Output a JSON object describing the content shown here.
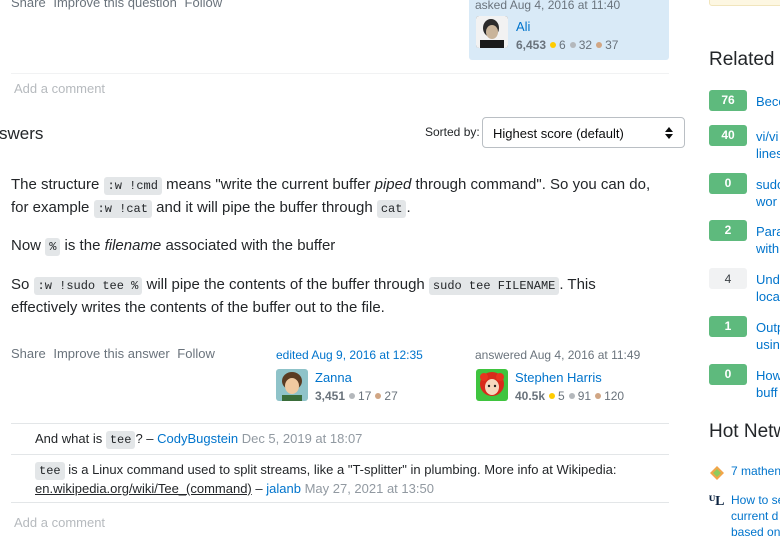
{
  "question_footer": {
    "share": "Share",
    "improve": "Improve this question",
    "follow": "Follow",
    "asked_label": "asked Aug 4, 2016 at 11:40",
    "asker": {
      "name": "Ali",
      "rep": "6,453",
      "gold": "6",
      "silver": "32",
      "bronze": "37"
    },
    "add_comment": "Add a comment"
  },
  "answers_header": {
    "title": "swers",
    "sorted_by": "Sorted by:",
    "sort_value": "Highest score (default)"
  },
  "answer": {
    "p1": {
      "t1": "The structure ",
      "c1": ":w !cmd",
      "t2": " means \"write the current buffer ",
      "em": "piped",
      "t3": " through command\". So you can do,",
      "t4": "for example ",
      "c2": ":w !cat",
      "t5": " and it will pipe the buffer through ",
      "c3": "cat",
      "t6": "."
    },
    "p2": {
      "t1": "Now ",
      "c1": "%",
      "t2": " is the ",
      "em": "filename",
      "t3": " associated with the buffer"
    },
    "p3": {
      "t1": "So ",
      "c1": ":w !sudo tee %",
      "t2": " will pipe the contents of the buffer through ",
      "c2": "sudo tee FILENAME",
      "t3": ". This",
      "t4": "effectively writes the contents of the buffer out to the file."
    },
    "share": "Share",
    "improve": "Improve this answer",
    "follow": "Follow",
    "edited_label": "edited Aug 9, 2016 at 12:35",
    "editor": {
      "name": "Zanna",
      "rep": "3,451",
      "silver": "17",
      "bronze": "27"
    },
    "answered_label": "answered Aug 4, 2016 at 11:49",
    "author": {
      "name": "Stephen Harris",
      "rep": "40.5k",
      "gold": "5",
      "silver": "91",
      "bronze": "120"
    }
  },
  "comments": [
    {
      "t1": "And what is ",
      "c1": "tee",
      "t2": "? – ",
      "user": "CodyBugstein",
      "date": "Dec 5, 2019 at 18:07"
    },
    {
      "c1": "tee",
      "t1": " is a Linux command used to split streams, like a \"T-splitter\" in plumbing. More info at Wikipedia:",
      "link": "en.wikipedia.org/wiki/Tee_(command)",
      "t2": " – ",
      "user": "jalanb",
      "date": "May 27, 2021 at 13:50"
    }
  ],
  "add_comment_2": "Add a comment",
  "sidebar": {
    "related_title": "Related",
    "related": [
      {
        "votes": "76",
        "text": "Beco"
      },
      {
        "votes": "40",
        "text": "vi/vi",
        "text2": "lines"
      },
      {
        "votes": "0",
        "text": "sudo",
        "text2": "wor"
      },
      {
        "votes": "2",
        "text": "Para",
        "text2": "with"
      },
      {
        "votes": "4",
        "text": "Und",
        "text2": "loca"
      },
      {
        "votes": "1",
        "text": "Outp",
        "text2": "usin"
      },
      {
        "votes": "0",
        "text": "How",
        "text2": "buff"
      }
    ],
    "hot_title": "Hot Netw",
    "hot": [
      {
        "text": "7 mathen"
      },
      {
        "text": "How to se",
        "text2": "current d",
        "text3": "based on"
      }
    ]
  },
  "colors": {
    "accent": "#0074cc",
    "answered_vote": "#5eba7d",
    "asker_card": "#d9eaf7"
  }
}
